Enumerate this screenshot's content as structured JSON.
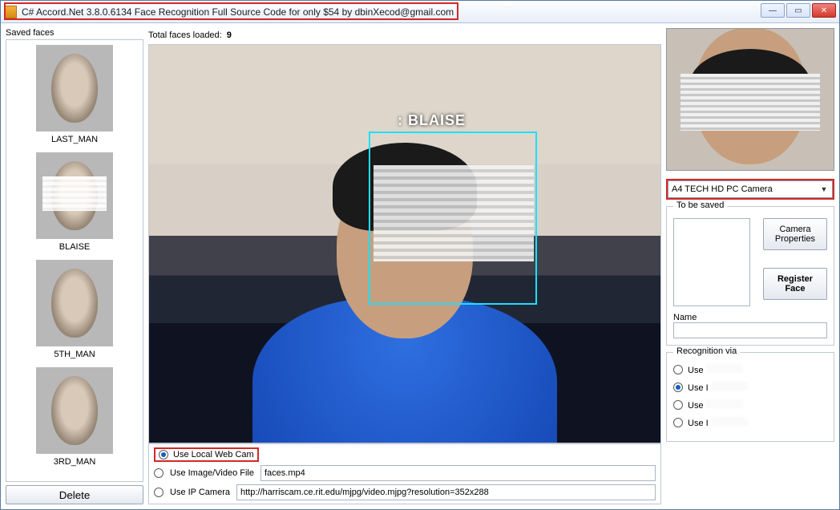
{
  "window": {
    "title": "C# Accord.Net 3.8.0.6134 Face Recognition Full Source Code for only $54 by dbinXecod@gmail.com"
  },
  "sidebar": {
    "label": "Saved faces",
    "faces": [
      {
        "name": "LAST_MAN",
        "censored": false
      },
      {
        "name": "BLAISE",
        "censored": true
      },
      {
        "name": "5TH_MAN",
        "censored": false
      },
      {
        "name": "3RD_MAN",
        "censored": false
      }
    ],
    "delete_label": "Delete"
  },
  "main": {
    "total_label": "Total faces loaded:",
    "total_count": "9",
    "detection_label": ": BLAISE",
    "sources": {
      "webcam": {
        "label": "Use Local Web Cam",
        "selected": true
      },
      "file": {
        "label": "Use Image/Video File",
        "selected": false,
        "value": "faces.mp4"
      },
      "ip": {
        "label": "Use IP Camera",
        "selected": false,
        "value": "http://harriscam.ce.rit.edu/mjpg/video.mjpg?resolution=352x288"
      }
    }
  },
  "right": {
    "camera_selected": "A4 TECH HD PC Camera",
    "to_be_saved_label": "To be saved",
    "camera_props_label": "Camera Properties",
    "register_label": "Register Face",
    "name_label": "Name",
    "name_value": "",
    "recognition": {
      "legend": "Recognition via",
      "options": [
        {
          "label_prefix": "Use",
          "selected": false
        },
        {
          "label_prefix": "Use I",
          "selected": true
        },
        {
          "label_prefix": "Use",
          "selected": false
        },
        {
          "label_prefix": "Use I",
          "selected": false
        }
      ]
    }
  }
}
